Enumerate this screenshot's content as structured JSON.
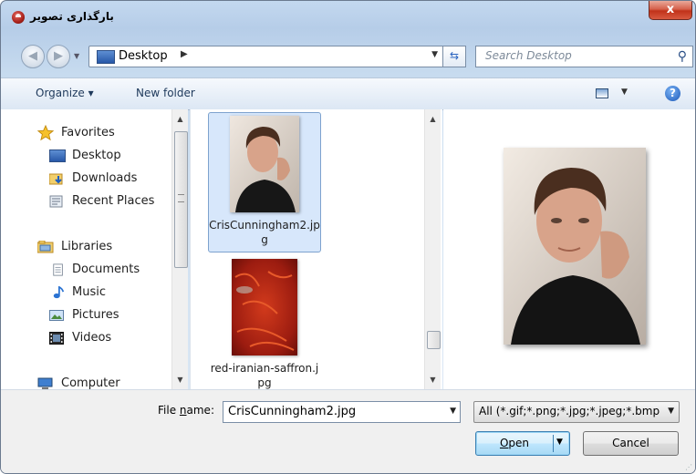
{
  "window": {
    "title": "بارگذاری تصویر",
    "close_glyph": "x"
  },
  "navbar": {
    "back_glyph": "◀",
    "forward_glyph": "▶",
    "address": "Desktop",
    "search_placeholder": "Search Desktop"
  },
  "toolbar": {
    "organize": "Organize ▾",
    "new_folder": "New folder",
    "help": "?"
  },
  "sidebar": {
    "favorites": {
      "label": "Favorites",
      "items": [
        {
          "label": "Desktop"
        },
        {
          "label": "Downloads"
        },
        {
          "label": "Recent Places"
        }
      ]
    },
    "libraries": {
      "label": "Libraries",
      "items": [
        {
          "label": "Documents"
        },
        {
          "label": "Music"
        },
        {
          "label": "Pictures"
        },
        {
          "label": "Videos"
        }
      ]
    },
    "computer": {
      "label": "Computer"
    }
  },
  "files": [
    {
      "name": "CrisCunningham2.jpg",
      "selected": true
    },
    {
      "name": "red-iranian-saffron.jpg",
      "selected": false
    }
  ],
  "bottom": {
    "file_name_label_pre": "File ",
    "file_name_label_key": "n",
    "file_name_label_post": "ame:",
    "file_name_value": "CrisCunningham2.jpg",
    "filter_value": "All (*.gif;*.png;*.jpg;*.jpeg;*.bmp)",
    "open_key": "O",
    "open_rest": "pen",
    "cancel_label": "Cancel"
  },
  "colors": {
    "selection": "#d7e7fb",
    "selection_border": "#7da2ce",
    "link": "#1e395b"
  }
}
